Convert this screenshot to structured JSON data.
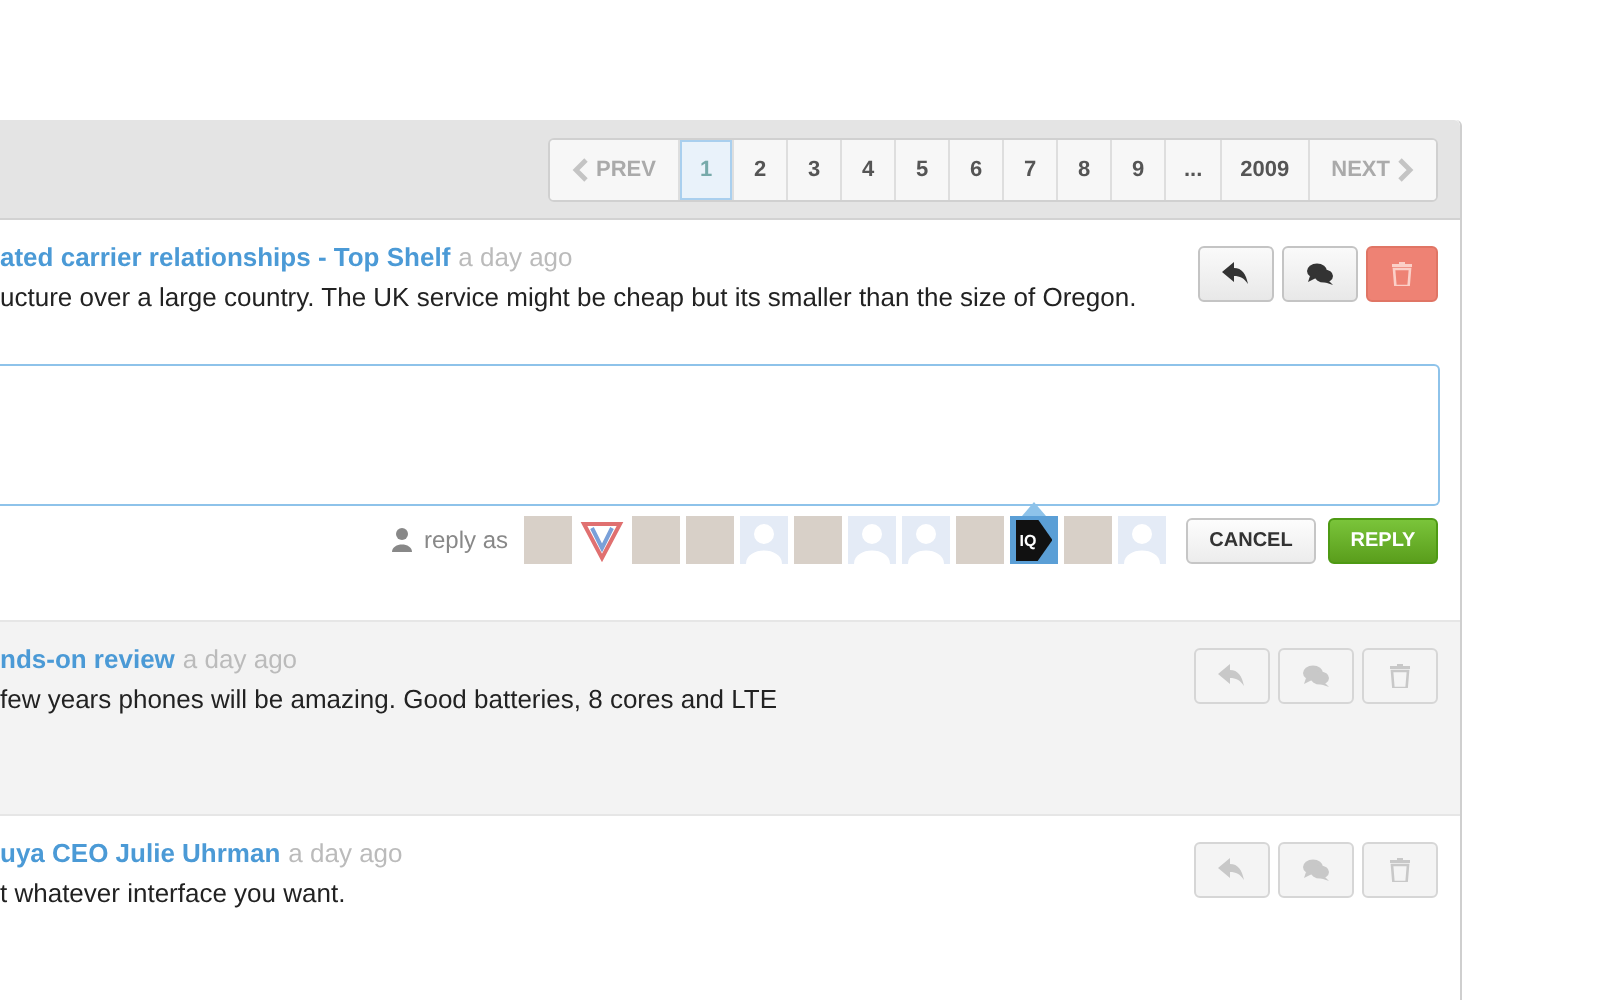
{
  "pagination": {
    "prev": "PREV",
    "next": "NEXT",
    "pages": [
      {
        "label": "1",
        "selected": true
      },
      {
        "label": "2",
        "selected": false
      },
      {
        "label": "3",
        "selected": false
      },
      {
        "label": "4",
        "selected": false
      },
      {
        "label": "5",
        "selected": false
      },
      {
        "label": "6",
        "selected": false
      },
      {
        "label": "7",
        "selected": false
      },
      {
        "label": "8",
        "selected": false
      },
      {
        "label": "9",
        "selected": false
      },
      {
        "label": "...",
        "selected": false
      },
      {
        "label": "2009",
        "selected": false
      }
    ]
  },
  "comments": [
    {
      "title": "ated carrier relationships - Top Shelf",
      "time": "a day ago",
      "body": "ucture over a large country. The UK service might be cheap but its smaller than the size of Oregon.",
      "active": true,
      "shaded": false,
      "reply_box": {
        "reply_as": "reply as",
        "cancel": "CANCEL",
        "reply": "REPLY",
        "avatars": [
          {
            "kind": "photo",
            "selected": false
          },
          {
            "kind": "v-logo",
            "selected": false
          },
          {
            "kind": "photo",
            "selected": false
          },
          {
            "kind": "photo",
            "selected": false
          },
          {
            "kind": "silhouette",
            "selected": false
          },
          {
            "kind": "photo",
            "selected": false
          },
          {
            "kind": "silhouette",
            "selected": false
          },
          {
            "kind": "silhouette",
            "selected": false
          },
          {
            "kind": "photo",
            "selected": false
          },
          {
            "kind": "iq-logo",
            "label": "IQ",
            "selected": true
          },
          {
            "kind": "photo",
            "selected": false
          },
          {
            "kind": "silhouette",
            "selected": false
          }
        ]
      }
    },
    {
      "title": "nds-on review",
      "time": "a day ago",
      "body": "few years phones will be amazing. Good batteries, 8 cores and LTE",
      "active": false,
      "shaded": true
    },
    {
      "title": "uya CEO Julie Uhrman",
      "time": "a day ago",
      "body": "t whatever interface you want.",
      "active": false,
      "shaded": false
    }
  ]
}
